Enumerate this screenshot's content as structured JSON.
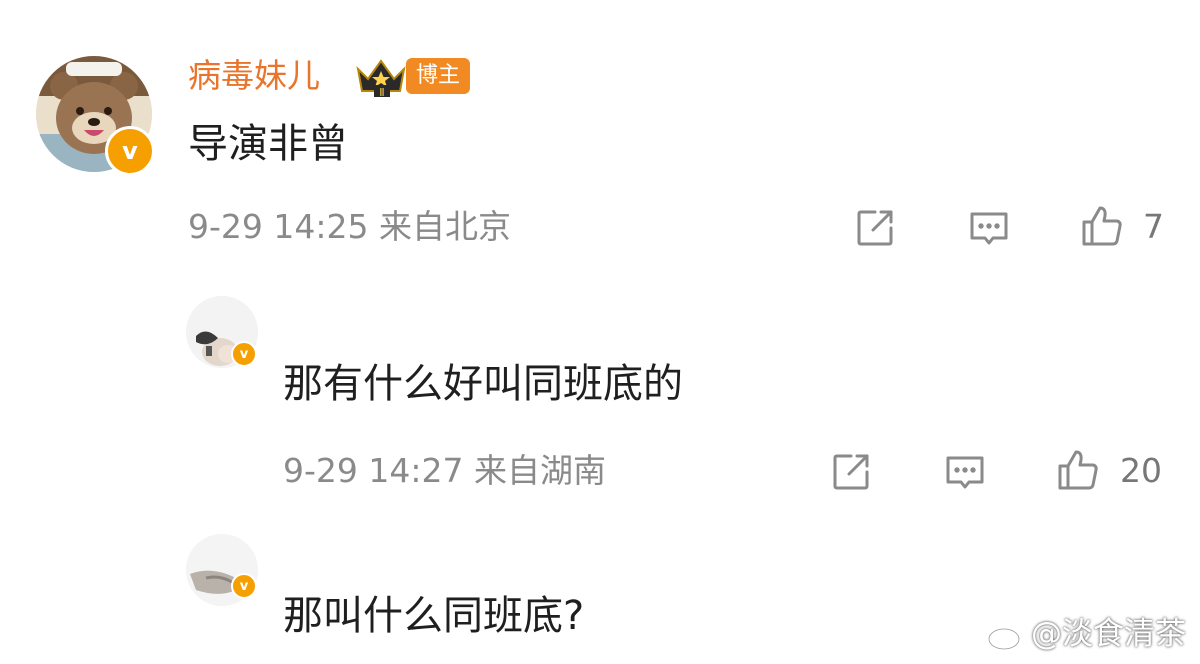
{
  "main_comment": {
    "username": "病毒妹儿",
    "badge": "博主",
    "badge_color": "#f28a23",
    "crown_level": "Ⅱ",
    "verified_mark": "v",
    "text": "导演非曾",
    "meta": "9-29 14:25  来自北京",
    "likes": "7"
  },
  "replies": [
    {
      "verified_mark": "v",
      "text": "那有什么好叫同班底的",
      "meta": "9-29 14:27  来自湖南",
      "likes": "20"
    },
    {
      "verified_mark": "v",
      "text": "那叫什么同班底?"
    }
  ],
  "watermark": "@淡食清茶",
  "colors": {
    "username": "#e8752b",
    "verified": "#f5a000",
    "meta": "#8a8a8a"
  },
  "icons": [
    "share-icon",
    "comment-icon",
    "like-icon",
    "crown-icon",
    "weibo-logo-icon"
  ]
}
